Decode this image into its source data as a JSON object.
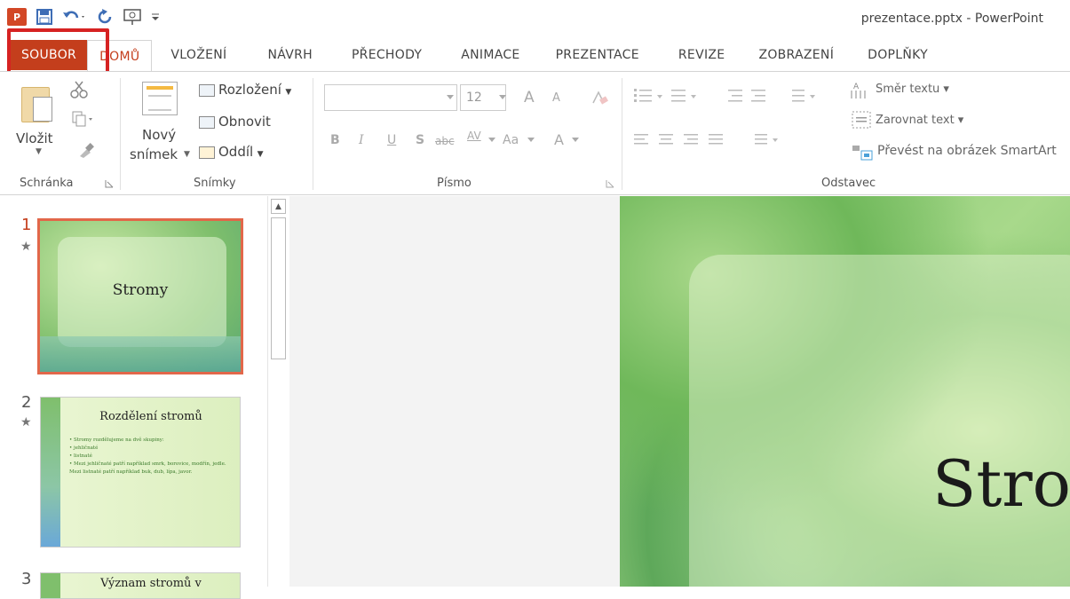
{
  "window": {
    "title": "prezentace.pptx - PowerPoint",
    "app_logo": "P"
  },
  "qat": {
    "icons": [
      "powerpoint-logo-icon",
      "save-icon",
      "undo-icon",
      "redo-icon",
      "start-slideshow-icon",
      "customize-qat-icon"
    ]
  },
  "tabs": [
    {
      "label": "SOUBOR",
      "kind": "file"
    },
    {
      "label": "DOMŮ",
      "kind": "active"
    },
    {
      "label": "VLOŽENÍ"
    },
    {
      "label": "NÁVRH"
    },
    {
      "label": "PŘECHODY"
    },
    {
      "label": "ANIMACE"
    },
    {
      "label": "PREZENTACE"
    },
    {
      "label": "REVIZE"
    },
    {
      "label": "ZOBRAZENÍ"
    },
    {
      "label": "DOPLŇKY"
    }
  ],
  "ribbon": {
    "clipboard": {
      "paste": "Vložit",
      "group": "Schránka"
    },
    "slides": {
      "new_slide_1": "Nový",
      "new_slide_2": "snímek",
      "layout": "Rozložení",
      "reset": "Obnovit",
      "section": "Oddíl",
      "group": "Snímky"
    },
    "font": {
      "size": "12",
      "bold": "B",
      "italic": "I",
      "underline": "U",
      "shadow": "S",
      "strike": "abc",
      "spacing": "AV",
      "case": "Aa",
      "color": "A",
      "grow": "A",
      "shrink": "A",
      "group": "Písmo"
    },
    "paragraph": {
      "direction": "Směr textu",
      "align": "Zarovnat text",
      "smartart": "Převést na obrázek SmartArt",
      "group": "Odstavec"
    }
  },
  "slides": [
    {
      "num": "1",
      "title": "Stromy"
    },
    {
      "num": "2",
      "title": "Rozdělení stromů",
      "bullets": [
        "Stromy rozdělujeme na dvě skupiny:",
        "jehličnaté",
        "listnaté",
        "Mezi jehličnaté patří například smrk, borovice, modřín, jedle. Mezi listnaté patří například buk, dub, lípa, javor."
      ]
    },
    {
      "num": "3",
      "title": "Význam stromů v"
    }
  ],
  "editor": {
    "title_visible": "Stro"
  }
}
